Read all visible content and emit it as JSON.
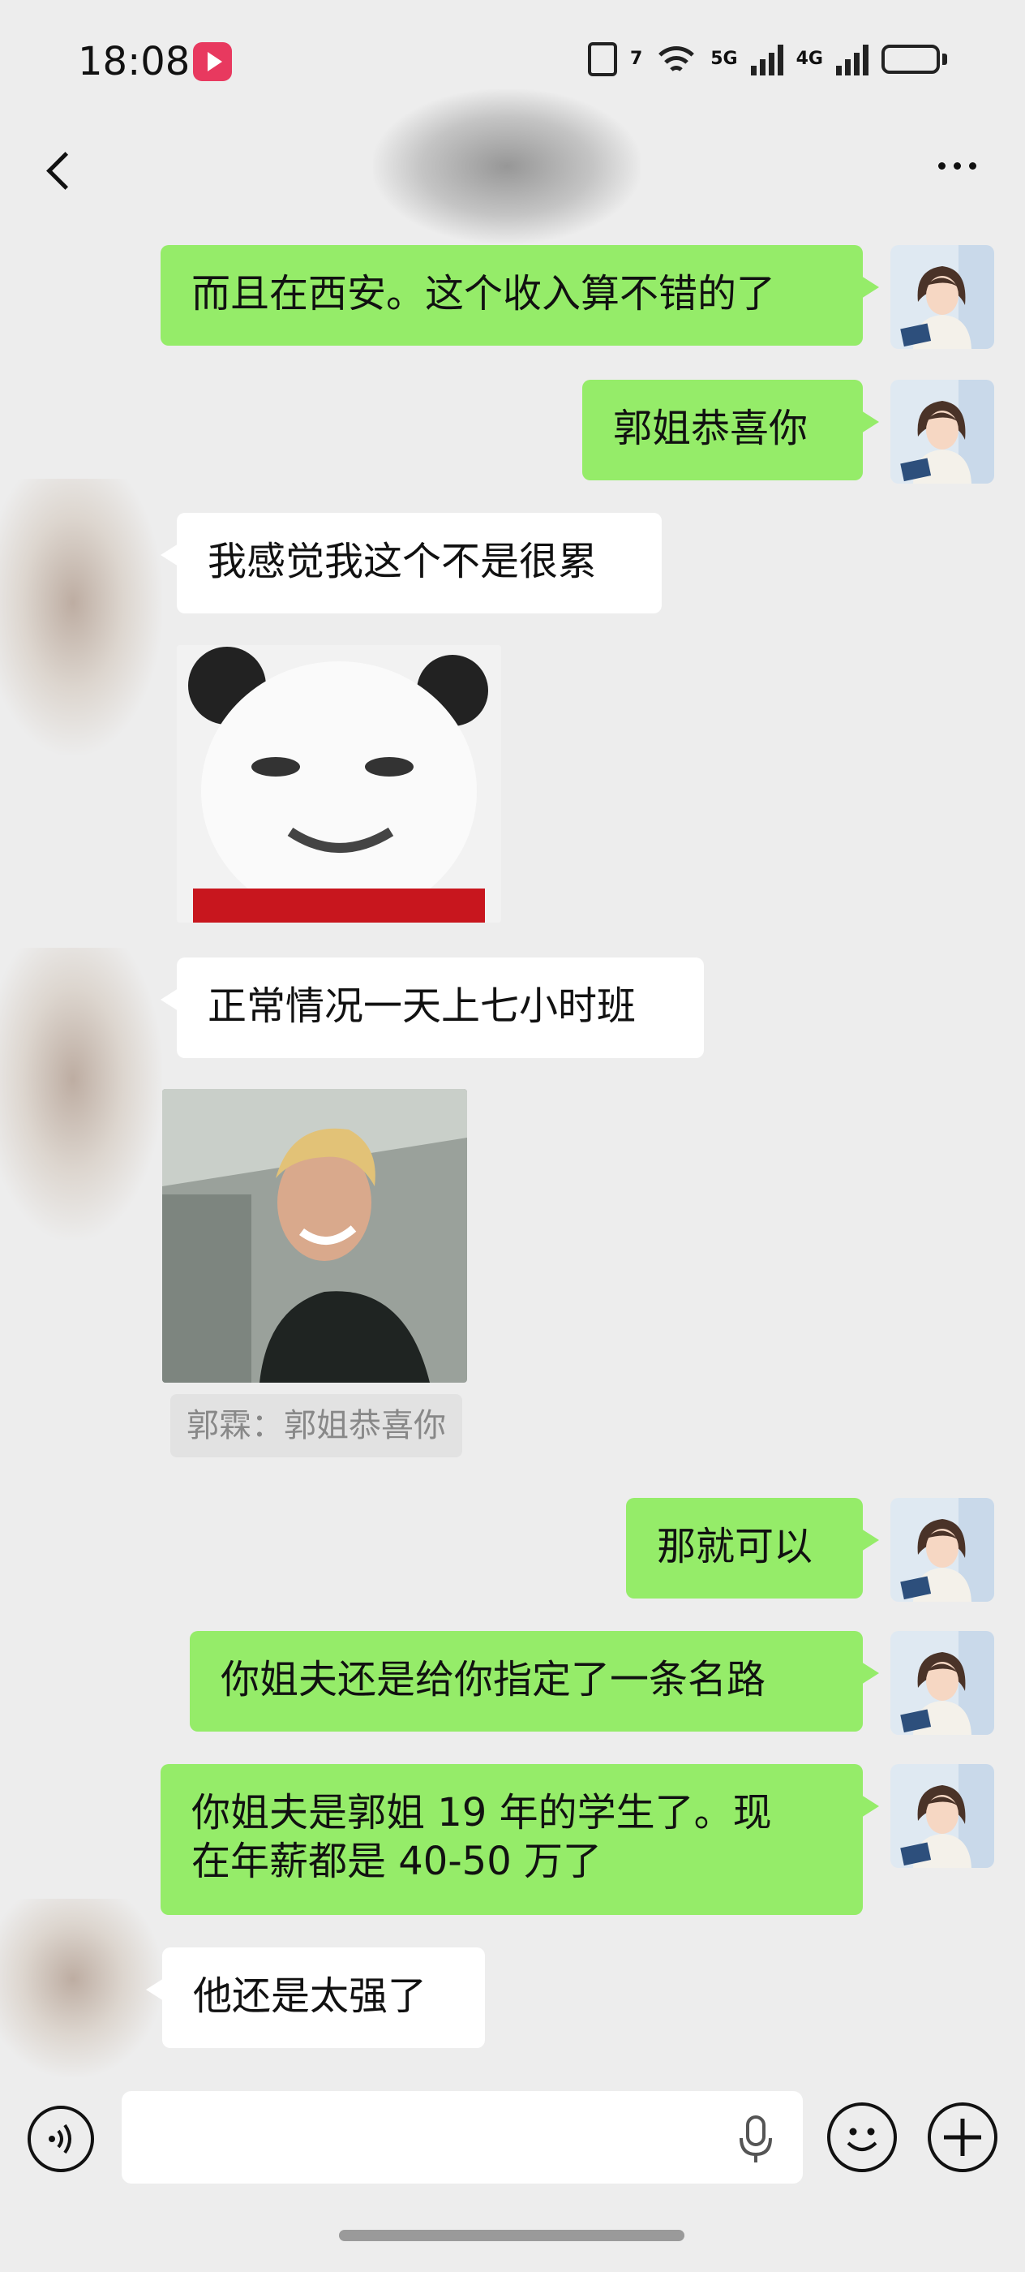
{
  "status_bar": {
    "time": "18:08",
    "network_primary": "5G",
    "network_secondary": "4G",
    "wifi_badge": "7",
    "battery_level": 0.7
  },
  "header": {
    "back_icon": "chevron-left-icon",
    "more_icon": "more-dots-icon"
  },
  "messages": [
    {
      "side": "out",
      "text": "而且在西安。这个收入算不错的了"
    },
    {
      "side": "out",
      "text": "郭姐恭喜你"
    },
    {
      "side": "in",
      "text": "我感觉我这个不是很累"
    },
    {
      "side": "in",
      "type": "sticker",
      "sticker": "panda-face"
    },
    {
      "side": "in",
      "text": "正常情况一天上七小时班"
    },
    {
      "side": "in",
      "type": "sticker",
      "sticker": "smiling-man",
      "quote": "郭霖：郭姐恭喜你"
    },
    {
      "side": "out",
      "text": "那就可以"
    },
    {
      "side": "out",
      "text": "你姐夫还是给你指定了一条名路"
    },
    {
      "side": "out",
      "text": "你姐夫是郭姐 19 年的学生了。现\n在年薪都是 40-50 万了"
    },
    {
      "side": "in",
      "text": "他还是太强了"
    }
  ],
  "input_bar": {
    "voice_icon": "voice-icon",
    "mic_icon": "mic-icon",
    "emoji_icon": "emoji-icon",
    "plus_icon": "plus-icon"
  },
  "colors": {
    "background": "#ededed",
    "outgoing_bubble": "#95ec69",
    "incoming_bubble": "#ffffff",
    "record_badge": "#e8395f"
  }
}
